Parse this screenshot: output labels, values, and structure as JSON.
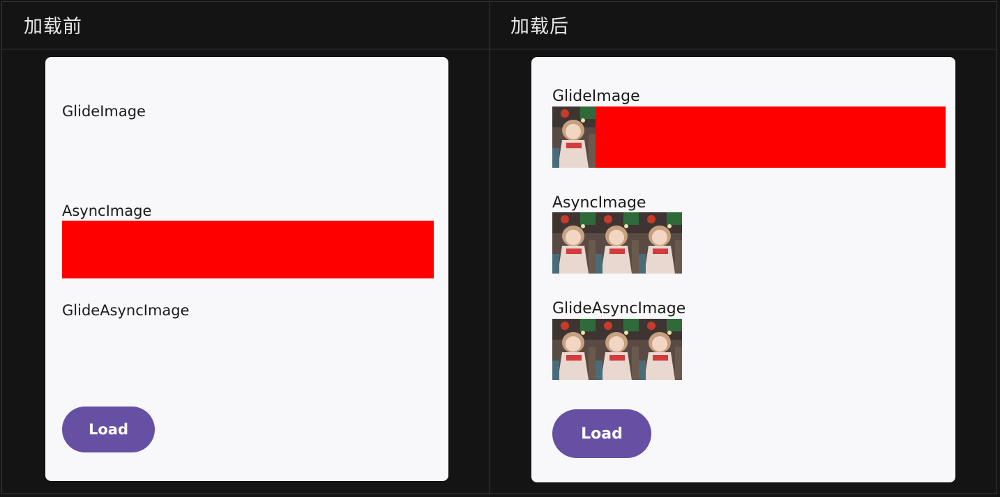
{
  "columns": {
    "before_title": "加载前",
    "after_title": "加载后"
  },
  "before": {
    "glide_label": "GlideImage",
    "async_label": "AsyncImage",
    "glide_async_label": "GlideAsyncImage",
    "load_label": "Load",
    "placeholder_color": "#ff0000"
  },
  "after": {
    "glide_label": "GlideImage",
    "async_label": "AsyncImage",
    "glide_async_label": "GlideAsyncImage",
    "load_label": "Load",
    "placeholder_color": "#ff0000"
  },
  "colors": {
    "accent": "#6650a4",
    "background": "#141414",
    "panel": "#f8f8fa"
  }
}
